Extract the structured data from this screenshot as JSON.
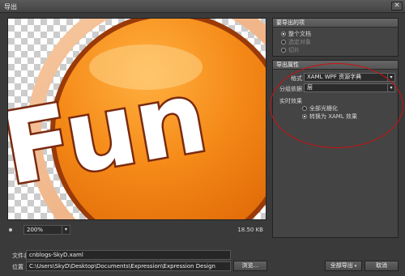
{
  "window": {
    "title": "导出",
    "close_glyph": "✕"
  },
  "preview": {
    "image_text": "Fun",
    "image_alt": "Fun button artwork preview"
  },
  "zoom": {
    "value": "200%",
    "arrow": "▾"
  },
  "file_size": "18.50 KB",
  "export_area": {
    "header": "要导出的项",
    "options": [
      {
        "label": "整个文档",
        "selected": true,
        "enabled": true
      },
      {
        "label": "选定对象",
        "selected": false,
        "enabled": false
      },
      {
        "label": "切片",
        "selected": false,
        "enabled": false
      }
    ]
  },
  "export_props": {
    "header": "导出属性",
    "format_label": "格式",
    "format_value": "XAML WPF 资源字典",
    "group_label": "分组依据",
    "group_value": "层",
    "live_effects_label": "实时效果",
    "effects": [
      {
        "label": "全部光栅化",
        "selected": false
      },
      {
        "label": "转换为 XAML 效果",
        "selected": true
      }
    ]
  },
  "file": {
    "name_label": "文件名",
    "name_value": "cnblogs-SkyD.xaml",
    "location_label": "位置",
    "location_value": "C:\\Users\\SkyD\\Desktop\\Documents\\Expression\\Expression Design",
    "browse_label": "浏览..."
  },
  "buttons": {
    "export_all": "全部导出",
    "cancel": "取消"
  },
  "colors": {
    "accent_red": "#d01010",
    "orange": "#f07a10"
  }
}
